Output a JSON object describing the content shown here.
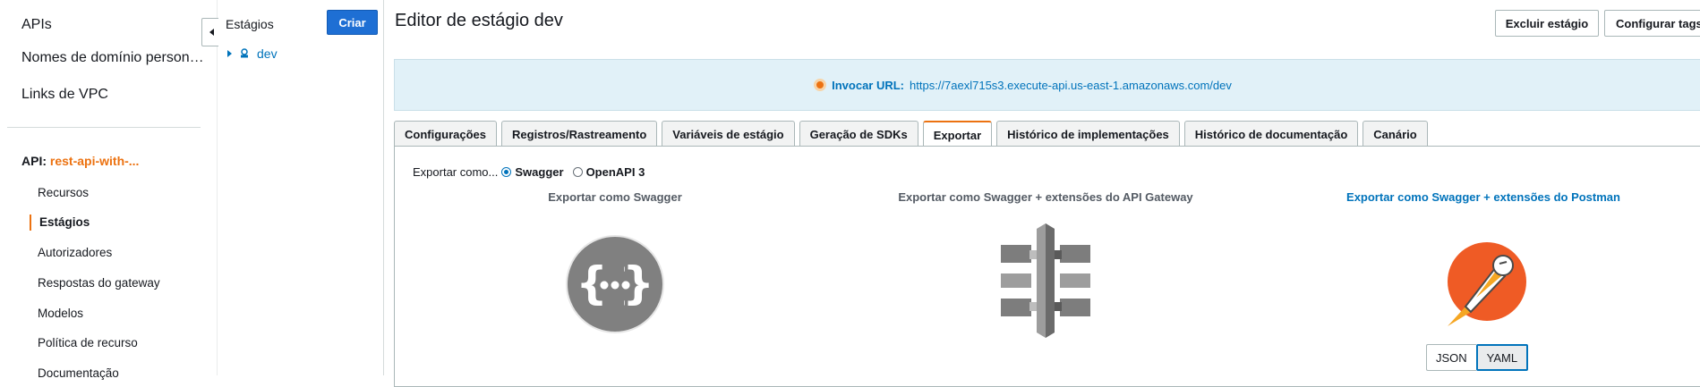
{
  "nav": {
    "top_items": [
      "APIs",
      "Nomes de domínio person…",
      "Links de VPC"
    ],
    "api_prefix": "API:",
    "api_name": "rest-api-with-...",
    "sub_items": [
      "Recursos",
      "Estágios",
      "Autorizadores",
      "Respostas do gateway",
      "Modelos",
      "Política de recurso",
      "Documentação"
    ]
  },
  "stages": {
    "title": "Estágios",
    "create_label": "Criar",
    "items": [
      "dev"
    ]
  },
  "main": {
    "title": "Editor de estágio dev",
    "delete_label": "Excluir estágio",
    "tags_label": "Configurar tags",
    "invoke_label": "Invocar URL:",
    "invoke_url": "https://7aexl715s3.execute-api.us-east-1.amazonaws.com/dev",
    "tabs": [
      "Configurações",
      "Registros/Rastreamento",
      "Variáveis de estágio",
      "Geração de SDKs",
      "Exportar",
      "Histórico de implementações",
      "Histórico de documentação",
      "Canário"
    ],
    "active_tab": "Exportar"
  },
  "export": {
    "export_as_label": "Exportar como...",
    "options": [
      "Swagger",
      "OpenAPI 3"
    ],
    "selected_option": "Swagger",
    "columns": [
      "Exportar como Swagger",
      "Exportar como Swagger + extensões do API Gateway",
      "Exportar como Swagger + extensões do Postman"
    ],
    "formats": [
      "JSON",
      "YAML"
    ],
    "selected_format": "YAML"
  },
  "colors": {
    "accent": "#ec7211",
    "link": "#0073bb",
    "primary_button": "#1e6fd4",
    "postman": "#ef5b25"
  },
  "icons": [
    "swagger-icon",
    "api-gateway-icon",
    "postman-icon"
  ]
}
